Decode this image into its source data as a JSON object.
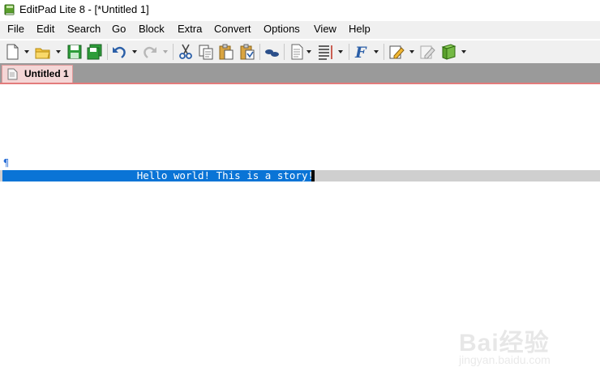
{
  "window": {
    "title": "EditPad Lite 8 - [*Untitled 1]"
  },
  "menu": [
    {
      "label": "File"
    },
    {
      "label": "Edit"
    },
    {
      "label": "Search"
    },
    {
      "label": "Go"
    },
    {
      "label": "Block"
    },
    {
      "label": "Extra"
    },
    {
      "label": "Convert"
    },
    {
      "label": "Options"
    },
    {
      "label": "View"
    },
    {
      "label": "Help"
    }
  ],
  "toolbar": {
    "icons": [
      "new-file-icon",
      "open-icon",
      "save-icon",
      "save-all-icon",
      "undo-icon",
      "redo-icon",
      "cut-icon",
      "copy-icon",
      "paste-icon",
      "paste-special-icon",
      "clipboard-icon",
      "document-icon",
      "word-wrap-icon",
      "font-icon",
      "edit-icon",
      "tools-icon",
      "book-icon"
    ]
  },
  "tabs": [
    {
      "label": "Untitled 1",
      "active": true
    }
  ],
  "editor": {
    "pilcrow": "¶",
    "line": "Hello world! This is a story!",
    "selection_color": "#0a74d6",
    "current_line_color": "#cfcfcf"
  },
  "watermark": {
    "brand": "Bai经验",
    "sub": "jingyan.baidu.com"
  },
  "colors": {
    "tab_bg": "#f4d6d6",
    "tab_border": "#e37b7b",
    "tabstrip_bg": "#9a9a9a"
  }
}
